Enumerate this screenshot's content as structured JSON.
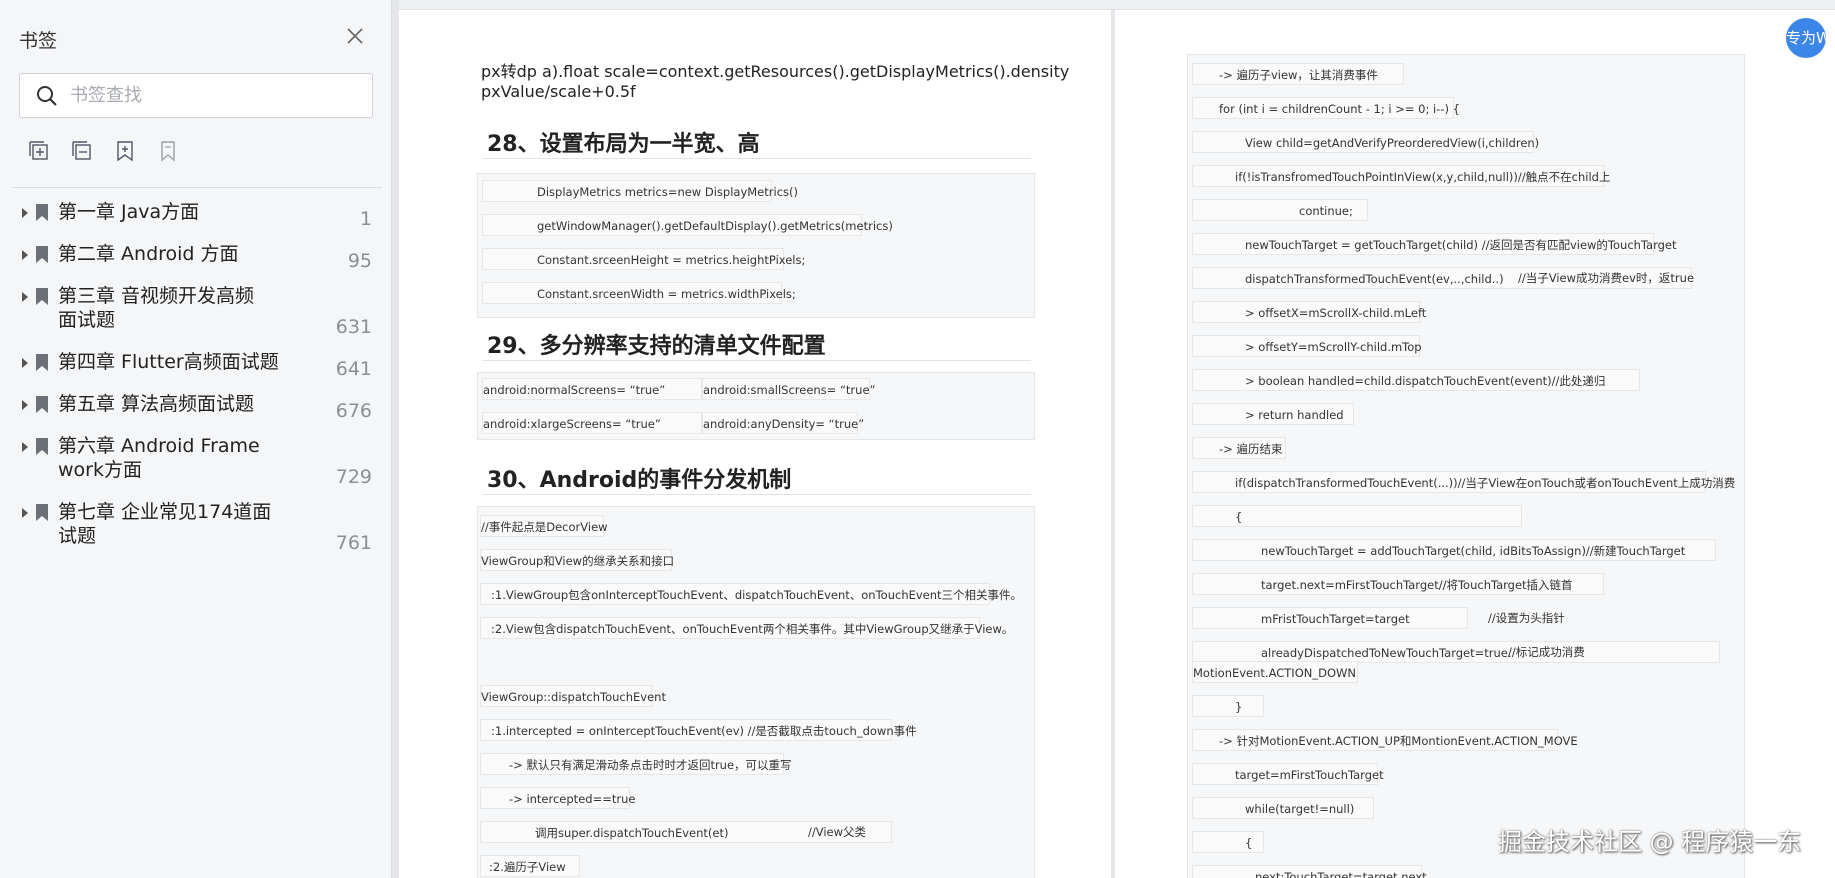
{
  "sidebar": {
    "title": "书签",
    "search_placeholder": "书签查找",
    "items": [
      {
        "label": "第一章 Java方面",
        "page": "1"
      },
      {
        "label": "第二章 Android 方面",
        "page": "95"
      },
      {
        "label": "第三章 音视频开发高频面试题",
        "page": "631"
      },
      {
        "label": "第四章 Flutter高频面试题",
        "page": "641"
      },
      {
        "label": "第五章 算法高频面试题",
        "page": "676"
      },
      {
        "label": "第六章 Android Framework方面",
        "page": "729"
      },
      {
        "label": "第七章 企业常见174道面试题",
        "page": "761"
      }
    ]
  },
  "left_page": {
    "intro_line1": "px转dp a).float scale=context.getResources().getDisplayMetrics().density",
    "intro_line2": "pxValue/scale+0.5f",
    "section28": "28、设置布局为一半宽、高",
    "code28": [
      "DisplayMetrics metrics=new DisplayMetrics()",
      "getWindowManager().getDefaultDisplay().getMetrics(metrics)",
      "Constant.srceenHeight = metrics.heightPixels;",
      "Constant.srceenWidth = metrics.widthPixels;"
    ],
    "section29": "29、多分辨率支持的清单文件配置",
    "code29": [
      {
        "a": "android:normalScreens= “true”",
        "b": "android:smallScreens= “true”"
      },
      {
        "a": "android:xlargeScreens= “true”",
        "b": "android:anyDensity= “true”"
      }
    ],
    "section30": "30、Android的事件分发机制",
    "code30": [
      "//事件起点是DecorView",
      "ViewGroup和View的继承关系和接口",
      ":1.ViewGroup包含onInterceptTouchEvent、dispatchTouchEvent、onTouchEvent三个相关事件。",
      ":2.View包含dispatchTouchEvent、onTouchEvent两个相关事件。其中ViewGroup又继承于View。",
      "",
      "ViewGroup::dispatchTouchEvent",
      ":1.intercepted = onInterceptTouchEvent(ev)   //是否截取点击touch_down事件",
      "-> 默认只有满足滑动条点击时时才返回true，可以重写",
      "-> intercepted==true",
      "调用super.dispatchTouchEvent(et)",
      ":2.遍历子View"
    ],
    "code30_comment": "//View父类"
  },
  "right_page": {
    "code": [
      "-> 遍历子view，让其消费事件",
      "for (int i = childrenCount - 1; i >= 0; i--) {",
      "View child=getAndVerifyPreorderedView(i,children)",
      "if(!isTransfromedTouchPointInView(x,y,child,null))//触点不在child上",
      "continue;",
      "newTouchTarget = getTouchTarget(child) //返回是否有匹配view的TouchTarget",
      "dispatchTransformedTouchEvent(ev,..,child..)",
      "> offsetX=mScrollX-child.mLeft",
      "> offsetY=mScrollY-child.mTop",
      "> boolean handled=child.dispatchTouchEvent(event)//此处递归",
      "> return handled",
      "-> 遍历结束",
      "if(dispatchTransformedTouchEvent(...))//当子View在onTouch或者onTouchEvent上成功消费",
      "{",
      "newTouchTarget = addTouchTarget(child, idBitsToAssign)//新建TouchTarget",
      "target.next=mFirstTouchTarget//将TouchTarget插入链首",
      "mFristTouchTarget=target",
      "alreadyDispatchedToNewTouchTarget=true.",
      "MotionEvent.ACTION_DOWN",
      "}",
      "-> 针对MotionEvent.ACTION_UP和MontionEvent.ACTION_MOVE",
      "target=mFirstTouchTarget",
      "while(target!=null)",
      "{",
      "next:TouchTarget=target.next"
    ],
    "comment_dispatch": "//当子View成功消费ev时，返true",
    "comment_first": "//设置为头指针",
    "comment_already": "//标记成功消费"
  },
  "avatar_text": "专为W",
  "watermark": "掘金技术社区 @ 程序猿一东"
}
